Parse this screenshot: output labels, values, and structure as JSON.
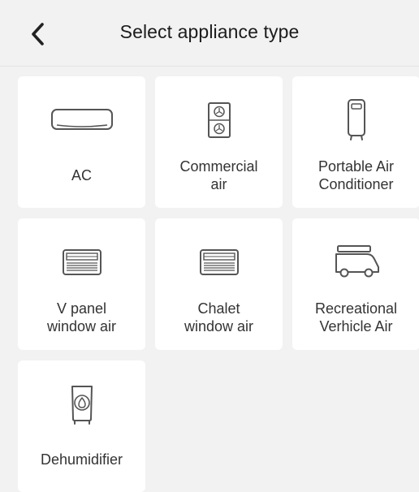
{
  "header": {
    "title": "Select appliance type",
    "back_icon": "chevron-left-icon"
  },
  "appliances": [
    {
      "label": "AC",
      "icon": "split-ac-icon"
    },
    {
      "label": "Commercial\nair",
      "icon": "commercial-air-icon"
    },
    {
      "label": "Portable Air\nConditioner",
      "icon": "portable-ac-icon"
    },
    {
      "label": "V panel\nwindow air",
      "icon": "window-ac-icon"
    },
    {
      "label": "Chalet\nwindow air",
      "icon": "window-ac-icon"
    },
    {
      "label": "Recreational\nVerhicle Air",
      "icon": "rv-icon"
    },
    {
      "label": "Dehumidifier",
      "icon": "dehumidifier-icon"
    }
  ],
  "colors": {
    "background": "#f2f2f2",
    "tile": "#ffffff",
    "icon_stroke": "#555555",
    "text": "#333333"
  }
}
